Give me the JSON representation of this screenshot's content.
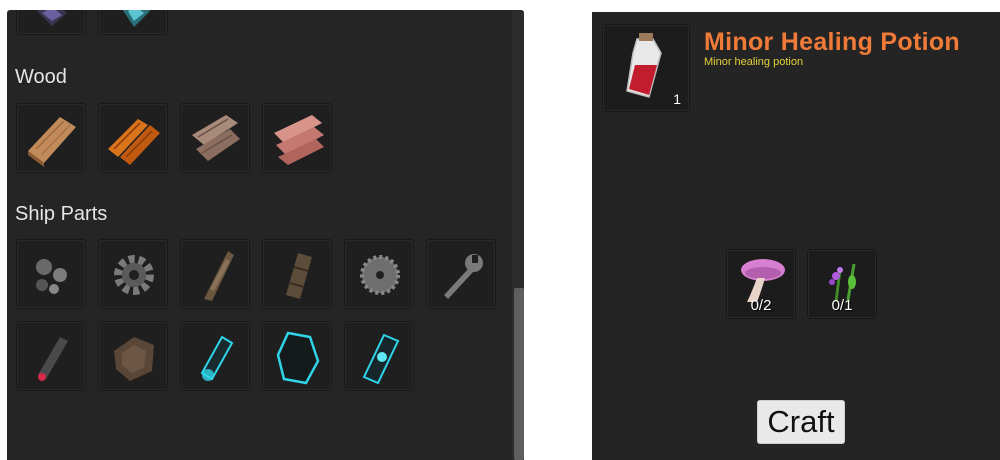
{
  "inventory": {
    "sections": [
      {
        "title": "Wood",
        "items": [
          "wood-plank-light",
          "wood-plank-orange",
          "wood-plank-weathered",
          "wood-plank-pink"
        ]
      },
      {
        "title": "Ship Parts",
        "items": [
          "scrap-metal",
          "gear",
          "hull-fragment",
          "barrel-canister",
          "saw-blade",
          "wrench",
          "red-capsule",
          "rusty-plate",
          "glowing-cylinder",
          "glowing-hex-plate",
          "glowing-crystal-core"
        ]
      }
    ]
  },
  "crafting": {
    "result": {
      "name": "Minor Healing Potion",
      "description": "Minor healing potion",
      "count": "1",
      "icon": "potion-icon"
    },
    "ingredients": [
      {
        "icon": "mushroom-icon",
        "count": "0/2"
      },
      {
        "icon": "herb-icon",
        "count": "0/1"
      }
    ],
    "craft_label": "Craft"
  },
  "colors": {
    "title_orange": "#f07a38",
    "desc_yellow": "#e3d23a",
    "panel_bg": "#242424",
    "glow_cyan": "#2fd4e8"
  }
}
